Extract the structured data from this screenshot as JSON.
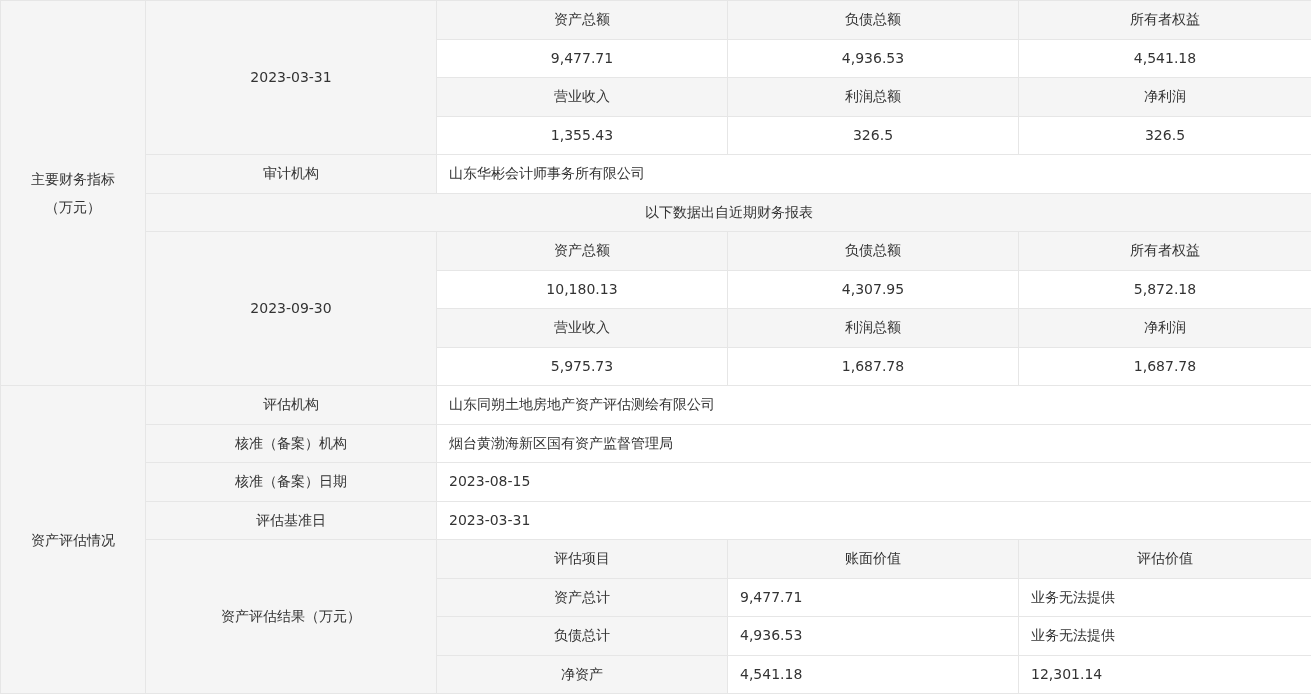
{
  "sections": [
    {
      "label": "主要财务指标",
      "sublabel": "（万元）",
      "rows": [
        {
          "kind": "metrics",
          "date": "2023-03-31",
          "groups": [
            {
              "headers": [
                "资产总额",
                "负债总额",
                "所有者权益"
              ],
              "values": [
                "9,477.71",
                "4,936.53",
                "4,541.18"
              ]
            },
            {
              "headers": [
                "营业收入",
                "利润总额",
                "净利润"
              ],
              "values": [
                "1,355.43",
                "326.5",
                "326.5"
              ]
            }
          ]
        },
        {
          "kind": "field",
          "label": "审计机构",
          "value": "山东华彬会计师事务所有限公司"
        },
        {
          "kind": "note",
          "text": "以下数据出自近期财务报表"
        },
        {
          "kind": "metrics",
          "date": "2023-09-30",
          "groups": [
            {
              "headers": [
                "资产总额",
                "负债总额",
                "所有者权益"
              ],
              "values": [
                "10,180.13",
                "4,307.95",
                "5,872.18"
              ]
            },
            {
              "headers": [
                "营业收入",
                "利润总额",
                "净利润"
              ],
              "values": [
                "5,975.73",
                "1,687.78",
                "1,687.78"
              ]
            }
          ]
        }
      ]
    },
    {
      "label": "资产评估情况",
      "rows": [
        {
          "kind": "field",
          "label": "评估机构",
          "value": "山东同朔土地房地产资产评估测绘有限公司"
        },
        {
          "kind": "field",
          "label": "核准（备案）机构",
          "value": "烟台黄渤海新区国有资产监督管理局"
        },
        {
          "kind": "field",
          "label": "核准（备案）日期",
          "value": "2023-08-15"
        },
        {
          "kind": "field",
          "label": "评估基准日",
          "value": "2023-03-31"
        },
        {
          "kind": "result",
          "label": "资产评估结果（万元）",
          "headers": [
            "评估项目",
            "账面价值",
            "评估价值"
          ],
          "items": [
            {
              "name": "资产总计",
              "book": "9,477.71",
              "appraised": "业务无法提供"
            },
            {
              "name": "负债总计",
              "book": "4,936.53",
              "appraised": "业务无法提供"
            },
            {
              "name": "净资产",
              "book": "4,541.18",
              "appraised": "12,301.14"
            }
          ]
        }
      ]
    }
  ]
}
